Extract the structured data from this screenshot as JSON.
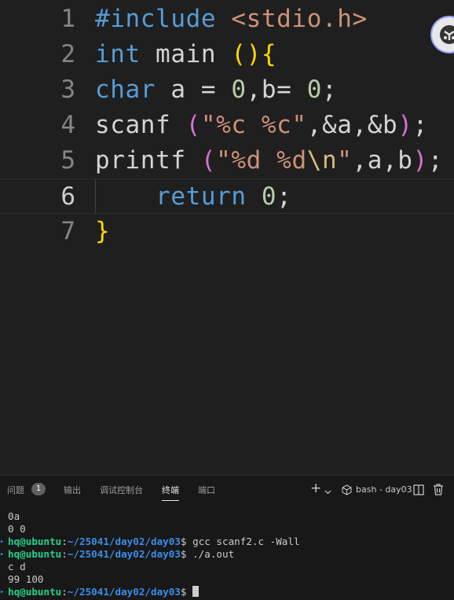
{
  "editor": {
    "lines": [
      {
        "num": "1",
        "t": [
          {
            "c": "pp",
            "v": "#include"
          },
          {
            "c": "",
            "v": " "
          },
          {
            "c": "inc",
            "v": "<stdio.h>"
          }
        ]
      },
      {
        "num": "2",
        "t": [
          {
            "c": "kw",
            "v": "int"
          },
          {
            "c": "",
            "v": " main "
          },
          {
            "c": "br1",
            "v": "()"
          },
          {
            "c": "br1",
            "v": "{"
          }
        ]
      },
      {
        "num": "3",
        "t": [
          {
            "c": "kw",
            "v": "char"
          },
          {
            "c": "",
            "v": " a = "
          },
          {
            "c": "num",
            "v": "0"
          },
          {
            "c": "",
            "v": ",b= "
          },
          {
            "c": "num",
            "v": "0"
          },
          {
            "c": "",
            "v": ";"
          }
        ]
      },
      {
        "num": "4",
        "t": [
          {
            "c": "fn",
            "v": "scanf"
          },
          {
            "c": "",
            "v": " "
          },
          {
            "c": "br2",
            "v": "("
          },
          {
            "c": "str",
            "v": "\"%c %c\""
          },
          {
            "c": "",
            "v": ",&a,&b"
          },
          {
            "c": "br2",
            "v": ")"
          },
          {
            "c": "",
            "v": ";"
          }
        ]
      },
      {
        "num": "5",
        "t": [
          {
            "c": "fn",
            "v": "printf"
          },
          {
            "c": "",
            "v": " "
          },
          {
            "c": "br2",
            "v": "("
          },
          {
            "c": "str",
            "v": "\"%d %d"
          },
          {
            "c": "esc",
            "v": "\\n"
          },
          {
            "c": "str",
            "v": "\""
          },
          {
            "c": "",
            "v": ",a,b"
          },
          {
            "c": "br2",
            "v": ")"
          },
          {
            "c": "",
            "v": ";"
          }
        ]
      },
      {
        "num": "6",
        "t": [
          {
            "c": "",
            "v": "    "
          },
          {
            "c": "kw",
            "v": "return"
          },
          {
            "c": "",
            "v": " "
          },
          {
            "c": "num",
            "v": "0"
          },
          {
            "c": "",
            "v": ";"
          }
        ]
      },
      {
        "num": "7",
        "t": [
          {
            "c": "br1",
            "v": "}"
          }
        ]
      }
    ]
  },
  "panel": {
    "tabs": {
      "problems": "问题",
      "problems_count": "1",
      "output": "输出",
      "debug_console": "调试控制台",
      "terminal": "终端",
      "ports": "端口"
    },
    "toolbar": {
      "new_terminal_icon": "plus-icon",
      "dropdown_icon": "chevron-down-icon",
      "terminal_name": "bash - day03",
      "split_icon": "split-icon",
      "trash_icon": "trash-icon"
    }
  },
  "terminal": {
    "lines": [
      {
        "type": "out",
        "text": "0a"
      },
      {
        "type": "out",
        "text": "0 0"
      },
      {
        "type": "prompt",
        "user": "hq@ubuntu",
        "path": "~/25041/day02/day03",
        "cmd": "gcc scanf2.c -Wall"
      },
      {
        "type": "prompt",
        "user": "hq@ubuntu",
        "path": "~/25041/day02/day03",
        "cmd": "./a.out"
      },
      {
        "type": "out",
        "text": "c d"
      },
      {
        "type": "out",
        "text": "99 100"
      },
      {
        "type": "prompt",
        "user": "hq@ubuntu",
        "path": "~/25041/day02/day03",
        "cmd": ""
      }
    ]
  }
}
